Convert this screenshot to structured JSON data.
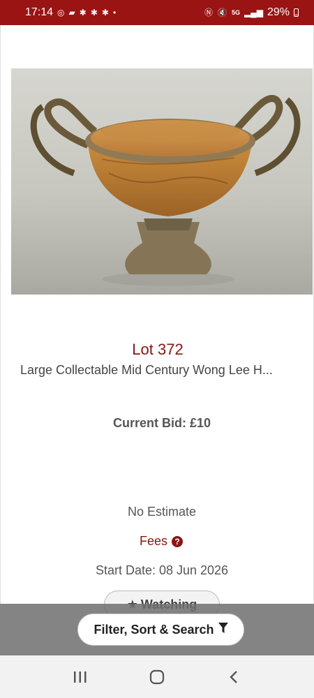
{
  "status_bar": {
    "time": "17:14",
    "battery": "29%",
    "network": "5G"
  },
  "lot": {
    "number": "Lot 372",
    "title": "Large Collectable Mid Century Wong Lee H...",
    "current_bid": "Current Bid: £10",
    "estimate": "No Estimate",
    "fees_label": "Fees",
    "start_date": "Start Date: 08 Jun 2026",
    "watching_label": "Watching"
  },
  "filter": {
    "label": "Filter, Sort & Search"
  },
  "icons": {
    "help": "?",
    "star": "★"
  },
  "colors": {
    "brand": "#9a1414",
    "accent_text": "#8b1414"
  }
}
